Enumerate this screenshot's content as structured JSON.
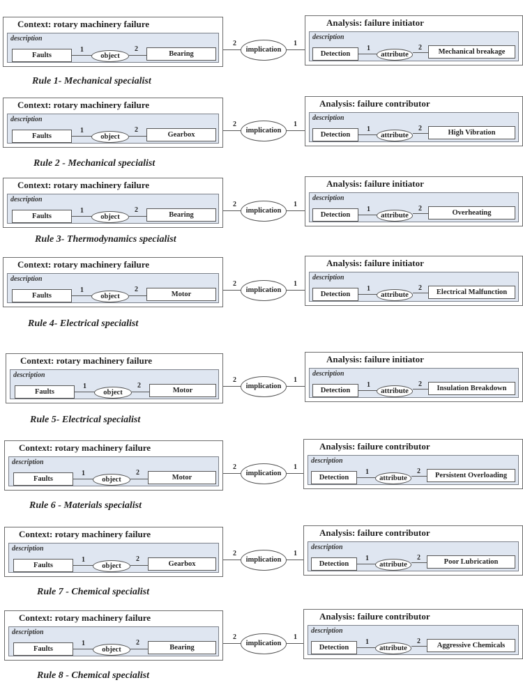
{
  "common": {
    "context_title": "Context: rotary machinery failure",
    "description_label": "description",
    "source_node": "Faults",
    "object_relation": "object",
    "implication_relation": "implication",
    "detection_node": "Detection",
    "attribute_relation": "attribute",
    "num_1": "1",
    "num_2": "2"
  },
  "rules": [
    {
      "component": "Bearing",
      "analysis_title": "Analysis: failure initiator",
      "finding": "Mechanical breakage",
      "caption": "Rule 1- Mechanical specialist"
    },
    {
      "component": "Gearbox",
      "analysis_title": "Analysis: failure contributor",
      "finding": "High Vibration",
      "caption": "Rule 2 - Mechanical specialist"
    },
    {
      "component": "Bearing",
      "analysis_title": "Analysis: failure initiator",
      "finding": "Overheating",
      "caption": "Rule 3- Thermodynamics specialist"
    },
    {
      "component": "Motor",
      "analysis_title": "Analysis: failure initiator",
      "finding": "Electrical Malfunction",
      "caption": "Rule 4- Electrical specialist"
    },
    {
      "component": "Motor",
      "analysis_title": "Analysis: failure initiator",
      "finding": "Insulation Breakdown",
      "caption": "Rule 5- Electrical specialist"
    },
    {
      "component": "Motor",
      "analysis_title": "Analysis: failure contributor",
      "finding": "Persistent Overloading",
      "caption": "Rule 6 - Materials specialist"
    },
    {
      "component": "Gearbox",
      "analysis_title": "Analysis: failure contributor",
      "finding": "Poor Lubrication",
      "caption": "Rule 7 - Chemical specialist"
    },
    {
      "component": "Bearing",
      "analysis_title": "Analysis: failure contributor",
      "finding": "Aggressive Chemicals",
      "caption": "Rule 8 - Chemical specialist"
    }
  ]
}
